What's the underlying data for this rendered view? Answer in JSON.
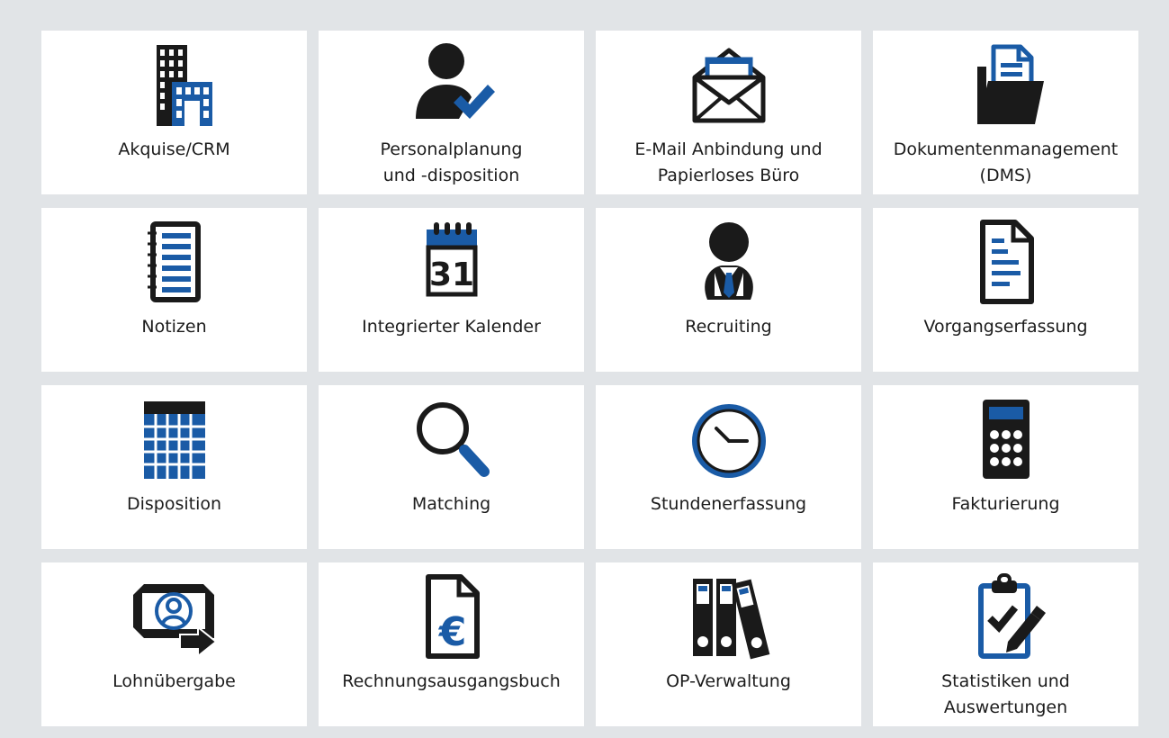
{
  "colors": {
    "page_background": "#e1e4e7",
    "tile_background": "#ffffff",
    "icon_dark": "#1a1a1a",
    "icon_accent": "#1a5ba6",
    "text": "#1c1c1c"
  },
  "modules": [
    {
      "icon": "buildings-icon",
      "label_lines": [
        "Akquise/CRM"
      ]
    },
    {
      "icon": "person-check-icon",
      "label_lines": [
        "Personalplanung",
        "und -disposition"
      ]
    },
    {
      "icon": "open-envelope-icon",
      "label_lines": [
        "E-Mail Anbindung und",
        "Papierloses Büro"
      ]
    },
    {
      "icon": "document-folder-icon",
      "label_lines": [
        "Dokumentenmanagement",
        "(DMS)"
      ]
    },
    {
      "icon": "notepad-icon",
      "label_lines": [
        "Notizen"
      ]
    },
    {
      "icon": "calendar-icon",
      "label_lines": [
        "Integrierter Kalender"
      ]
    },
    {
      "icon": "businessman-icon",
      "label_lines": [
        "Recruiting"
      ]
    },
    {
      "icon": "document-lines-icon",
      "label_lines": [
        "Vorgangserfassung"
      ]
    },
    {
      "icon": "grid-table-icon",
      "label_lines": [
        "Disposition"
      ]
    },
    {
      "icon": "magnifier-icon",
      "label_lines": [
        "Matching"
      ]
    },
    {
      "icon": "clock-icon",
      "label_lines": [
        "Stundenerfassung"
      ]
    },
    {
      "icon": "calculator-icon",
      "label_lines": [
        "Fakturierung"
      ]
    },
    {
      "icon": "payroll-transfer-icon",
      "label_lines": [
        "Lohnübergabe"
      ]
    },
    {
      "icon": "euro-document-icon",
      "label_lines": [
        "Rechnungsausgangsbuch"
      ]
    },
    {
      "icon": "binders-icon",
      "label_lines": [
        "OP-Verwaltung"
      ]
    },
    {
      "icon": "clipboard-check-icon",
      "label_lines": [
        "Statistiken und",
        "Auswertungen"
      ]
    }
  ]
}
